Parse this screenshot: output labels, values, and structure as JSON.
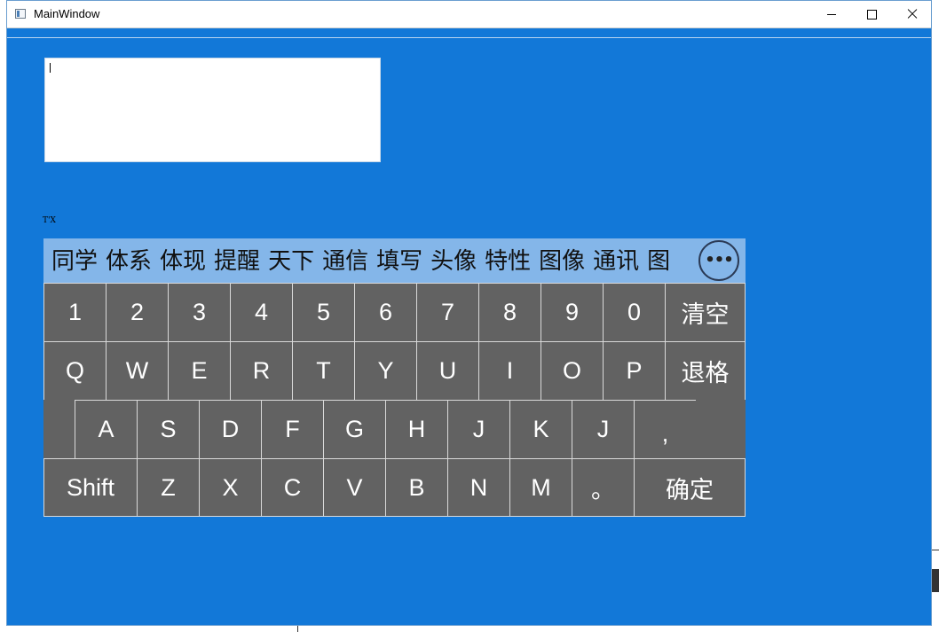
{
  "window": {
    "title": "MainWindow",
    "accent": "#1278d8"
  },
  "small_label": "T'X",
  "candidates": [
    "同学",
    "体系",
    "体现",
    "提醒",
    "天下",
    "通信",
    "填写",
    "头像",
    "特性",
    "图像",
    "通讯",
    "图"
  ],
  "more_button_label": "•••",
  "keys": {
    "row1": [
      "1",
      "2",
      "3",
      "4",
      "5",
      "6",
      "7",
      "8",
      "9",
      "0"
    ],
    "clear": "清空",
    "row2": [
      "Q",
      "W",
      "E",
      "R",
      "T",
      "Y",
      "U",
      "I",
      "O",
      "P"
    ],
    "backspace": "退格",
    "row3": [
      "A",
      "S",
      "D",
      "F",
      "G",
      "H",
      "J",
      "K",
      "J",
      ","
    ],
    "shift": "Shift",
    "row4": [
      "Z",
      "X",
      "C",
      "V",
      "B",
      "N",
      "M",
      "。"
    ],
    "confirm": "确定"
  },
  "colors": {
    "key_bg": "#626262",
    "candidate_bar_bg": "#84b6e9"
  }
}
